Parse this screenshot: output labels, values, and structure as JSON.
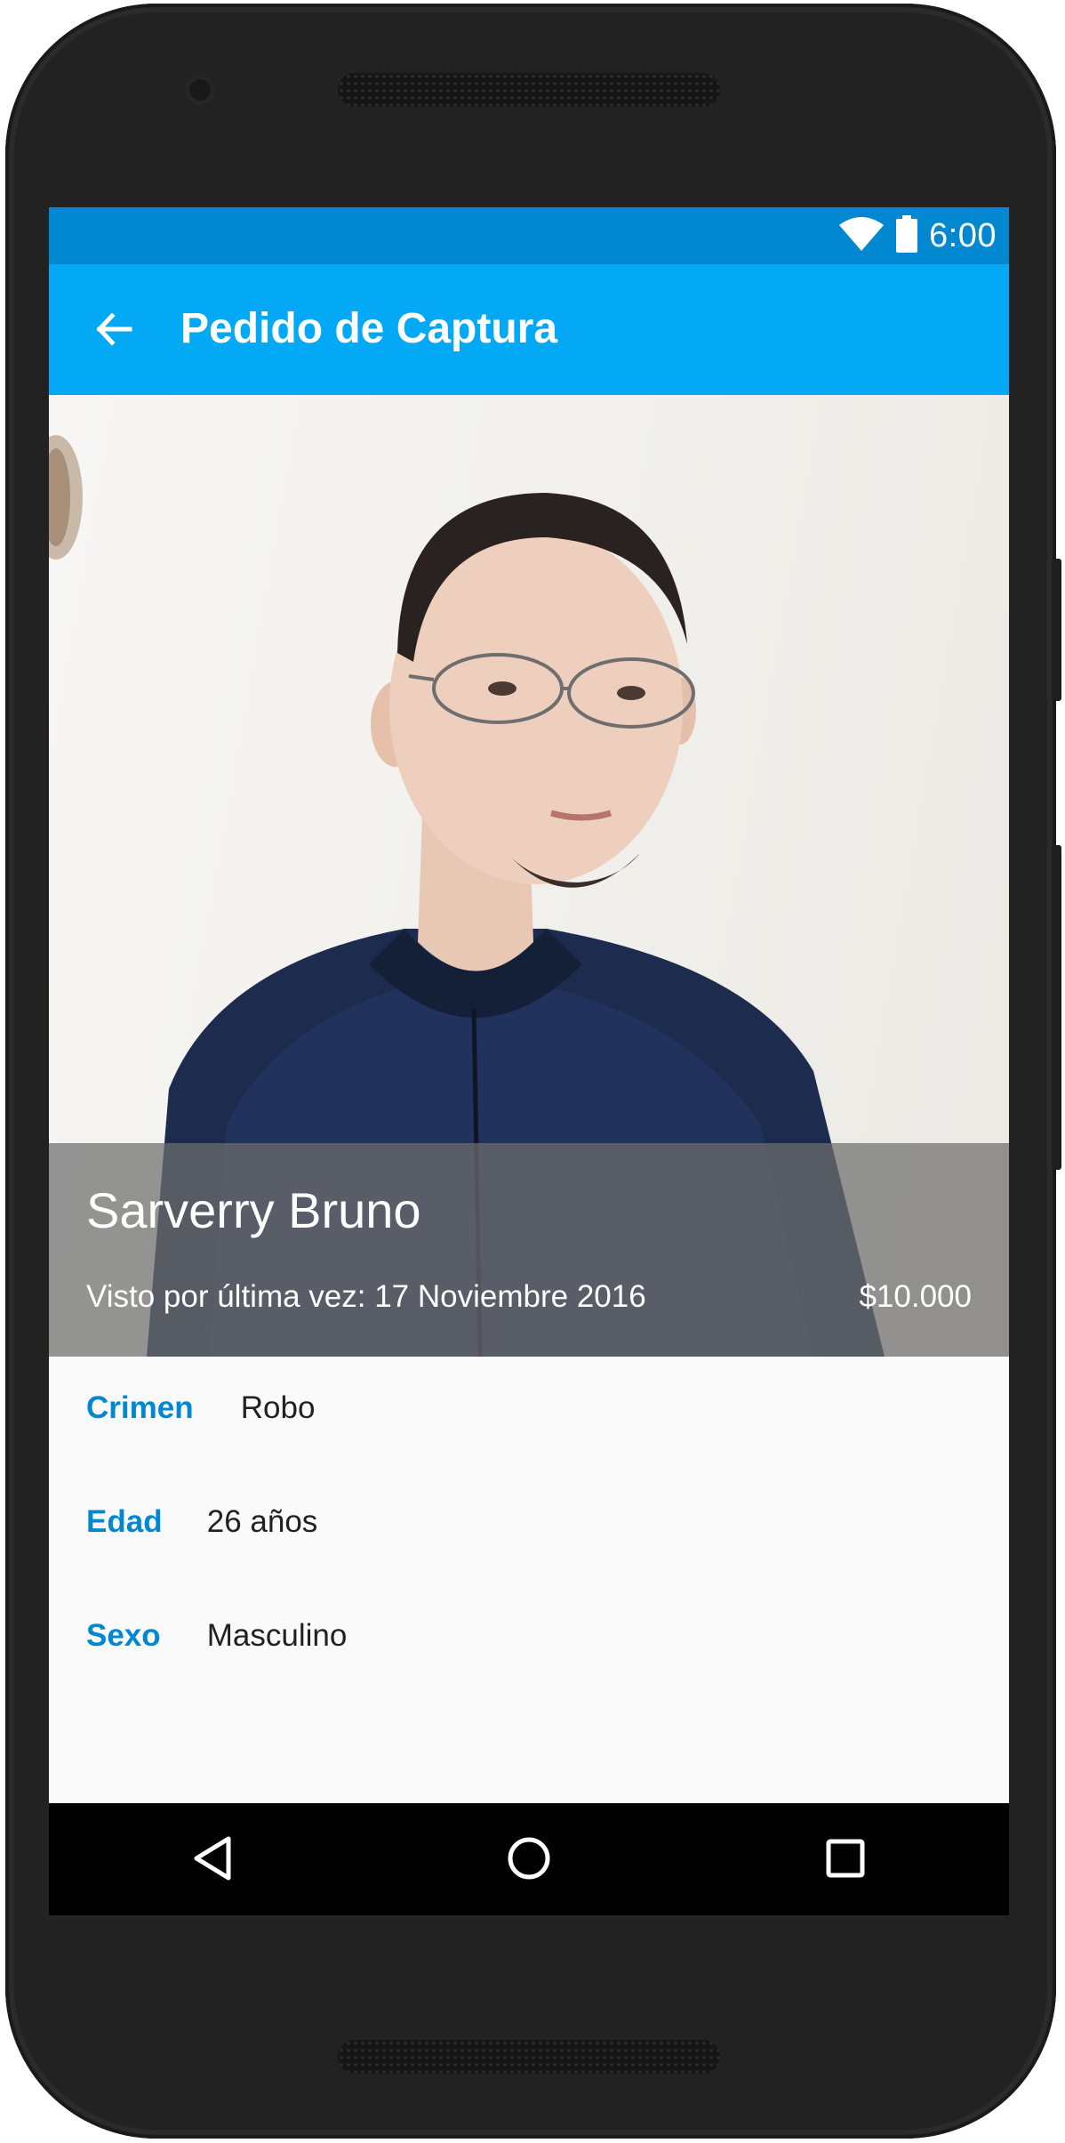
{
  "status_bar": {
    "time": "6:00",
    "icons": [
      "wifi-icon",
      "battery-icon"
    ]
  },
  "app_bar": {
    "title": "Pedido de Captura",
    "back_icon": "arrow-back-icon"
  },
  "wanted": {
    "name": "Sarverry Bruno",
    "last_seen": "Visto por última vez: 17 Noviembre 2016",
    "reward": "$10.000"
  },
  "details": [
    {
      "label": "Crimen",
      "value": "Robo"
    },
    {
      "label": "Edad",
      "value": "26 años"
    },
    {
      "label": "Sexo",
      "value": "Masculino"
    }
  ],
  "nav_bar": {
    "icons": [
      "back-triangle-icon",
      "home-circle-icon",
      "recents-square-icon"
    ]
  },
  "colors": {
    "status_bar": "#0288d1",
    "app_bar": "#03a9f4",
    "label_accent": "#0288d1"
  }
}
